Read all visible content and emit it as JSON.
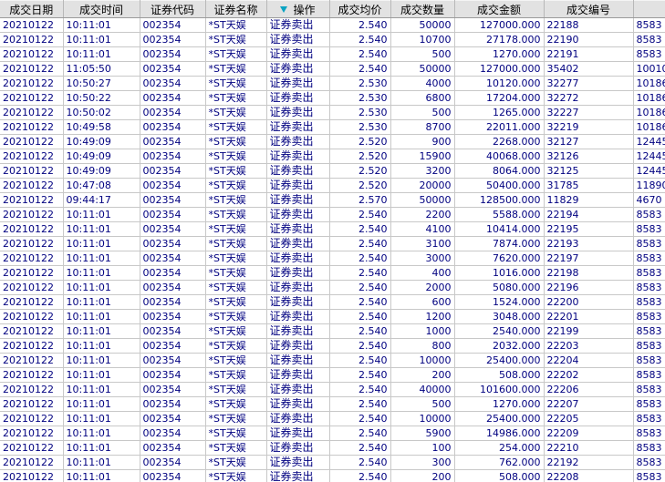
{
  "header": {
    "date": "成交日期",
    "time": "成交时间",
    "code": "证券代码",
    "name": "证券名称",
    "op": "操作",
    "price": "成交均价",
    "qty": "成交数量",
    "amount": "成交金额",
    "deal_no": "成交编号",
    "extra": ""
  },
  "rows": [
    {
      "date": "20210122",
      "time": "10:11:01",
      "code": "002354",
      "name": "*ST天娱",
      "op": "证券卖出",
      "price": "2.540",
      "qty": "50000",
      "amount": "127000.000",
      "deal_no": "22188",
      "extra": "8583"
    },
    {
      "date": "20210122",
      "time": "10:11:01",
      "code": "002354",
      "name": "*ST天娱",
      "op": "证券卖出",
      "price": "2.540",
      "qty": "10700",
      "amount": "27178.000",
      "deal_no": "22190",
      "extra": "8583"
    },
    {
      "date": "20210122",
      "time": "10:11:01",
      "code": "002354",
      "name": "*ST天娱",
      "op": "证券卖出",
      "price": "2.540",
      "qty": "500",
      "amount": "1270.000",
      "deal_no": "22191",
      "extra": "8583"
    },
    {
      "date": "20210122",
      "time": "11:05:50",
      "code": "002354",
      "name": "*ST天娱",
      "op": "证券卖出",
      "price": "2.540",
      "qty": "50000",
      "amount": "127000.000",
      "deal_no": "35402",
      "extra": "10010"
    },
    {
      "date": "20210122",
      "time": "10:50:27",
      "code": "002354",
      "name": "*ST天娱",
      "op": "证券卖出",
      "price": "2.530",
      "qty": "4000",
      "amount": "10120.000",
      "deal_no": "32277",
      "extra": "10186"
    },
    {
      "date": "20210122",
      "time": "10:50:22",
      "code": "002354",
      "name": "*ST天娱",
      "op": "证券卖出",
      "price": "2.530",
      "qty": "6800",
      "amount": "17204.000",
      "deal_no": "32272",
      "extra": "10186"
    },
    {
      "date": "20210122",
      "time": "10:50:02",
      "code": "002354",
      "name": "*ST天娱",
      "op": "证券卖出",
      "price": "2.530",
      "qty": "500",
      "amount": "1265.000",
      "deal_no": "32227",
      "extra": "10186"
    },
    {
      "date": "20210122",
      "time": "10:49:58",
      "code": "002354",
      "name": "*ST天娱",
      "op": "证券卖出",
      "price": "2.530",
      "qty": "8700",
      "amount": "22011.000",
      "deal_no": "32219",
      "extra": "10186"
    },
    {
      "date": "20210122",
      "time": "10:49:09",
      "code": "002354",
      "name": "*ST天娱",
      "op": "证券卖出",
      "price": "2.520",
      "qty": "900",
      "amount": "2268.000",
      "deal_no": "32127",
      "extra": "12445"
    },
    {
      "date": "20210122",
      "time": "10:49:09",
      "code": "002354",
      "name": "*ST天娱",
      "op": "证券卖出",
      "price": "2.520",
      "qty": "15900",
      "amount": "40068.000",
      "deal_no": "32126",
      "extra": "12445"
    },
    {
      "date": "20210122",
      "time": "10:49:09",
      "code": "002354",
      "name": "*ST天娱",
      "op": "证券卖出",
      "price": "2.520",
      "qty": "3200",
      "amount": "8064.000",
      "deal_no": "32125",
      "extra": "12445"
    },
    {
      "date": "20210122",
      "time": "10:47:08",
      "code": "002354",
      "name": "*ST天娱",
      "op": "证券卖出",
      "price": "2.520",
      "qty": "20000",
      "amount": "50400.000",
      "deal_no": "31785",
      "extra": "11890"
    },
    {
      "date": "20210122",
      "time": "09:44:17",
      "code": "002354",
      "name": "*ST天娱",
      "op": "证券卖出",
      "price": "2.570",
      "qty": "50000",
      "amount": "128500.000",
      "deal_no": "11829",
      "extra": "4670"
    },
    {
      "date": "20210122",
      "time": "10:11:01",
      "code": "002354",
      "name": "*ST天娱",
      "op": "证券卖出",
      "price": "2.540",
      "qty": "2200",
      "amount": "5588.000",
      "deal_no": "22194",
      "extra": "8583"
    },
    {
      "date": "20210122",
      "time": "10:11:01",
      "code": "002354",
      "name": "*ST天娱",
      "op": "证券卖出",
      "price": "2.540",
      "qty": "4100",
      "amount": "10414.000",
      "deal_no": "22195",
      "extra": "8583"
    },
    {
      "date": "20210122",
      "time": "10:11:01",
      "code": "002354",
      "name": "*ST天娱",
      "op": "证券卖出",
      "price": "2.540",
      "qty": "3100",
      "amount": "7874.000",
      "deal_no": "22193",
      "extra": "8583"
    },
    {
      "date": "20210122",
      "time": "10:11:01",
      "code": "002354",
      "name": "*ST天娱",
      "op": "证券卖出",
      "price": "2.540",
      "qty": "3000",
      "amount": "7620.000",
      "deal_no": "22197",
      "extra": "8583"
    },
    {
      "date": "20210122",
      "time": "10:11:01",
      "code": "002354",
      "name": "*ST天娱",
      "op": "证券卖出",
      "price": "2.540",
      "qty": "400",
      "amount": "1016.000",
      "deal_no": "22198",
      "extra": "8583"
    },
    {
      "date": "20210122",
      "time": "10:11:01",
      "code": "002354",
      "name": "*ST天娱",
      "op": "证券卖出",
      "price": "2.540",
      "qty": "2000",
      "amount": "5080.000",
      "deal_no": "22196",
      "extra": "8583"
    },
    {
      "date": "20210122",
      "time": "10:11:01",
      "code": "002354",
      "name": "*ST天娱",
      "op": "证券卖出",
      "price": "2.540",
      "qty": "600",
      "amount": "1524.000",
      "deal_no": "22200",
      "extra": "8583"
    },
    {
      "date": "20210122",
      "time": "10:11:01",
      "code": "002354",
      "name": "*ST天娱",
      "op": "证券卖出",
      "price": "2.540",
      "qty": "1200",
      "amount": "3048.000",
      "deal_no": "22201",
      "extra": "8583"
    },
    {
      "date": "20210122",
      "time": "10:11:01",
      "code": "002354",
      "name": "*ST天娱",
      "op": "证券卖出",
      "price": "2.540",
      "qty": "1000",
      "amount": "2540.000",
      "deal_no": "22199",
      "extra": "8583"
    },
    {
      "date": "20210122",
      "time": "10:11:01",
      "code": "002354",
      "name": "*ST天娱",
      "op": "证券卖出",
      "price": "2.540",
      "qty": "800",
      "amount": "2032.000",
      "deal_no": "22203",
      "extra": "8583"
    },
    {
      "date": "20210122",
      "time": "10:11:01",
      "code": "002354",
      "name": "*ST天娱",
      "op": "证券卖出",
      "price": "2.540",
      "qty": "10000",
      "amount": "25400.000",
      "deal_no": "22204",
      "extra": "8583"
    },
    {
      "date": "20210122",
      "time": "10:11:01",
      "code": "002354",
      "name": "*ST天娱",
      "op": "证券卖出",
      "price": "2.540",
      "qty": "200",
      "amount": "508.000",
      "deal_no": "22202",
      "extra": "8583"
    },
    {
      "date": "20210122",
      "time": "10:11:01",
      "code": "002354",
      "name": "*ST天娱",
      "op": "证券卖出",
      "price": "2.540",
      "qty": "40000",
      "amount": "101600.000",
      "deal_no": "22206",
      "extra": "8583"
    },
    {
      "date": "20210122",
      "time": "10:11:01",
      "code": "002354",
      "name": "*ST天娱",
      "op": "证券卖出",
      "price": "2.540",
      "qty": "500",
      "amount": "1270.000",
      "deal_no": "22207",
      "extra": "8583"
    },
    {
      "date": "20210122",
      "time": "10:11:01",
      "code": "002354",
      "name": "*ST天娱",
      "op": "证券卖出",
      "price": "2.540",
      "qty": "10000",
      "amount": "25400.000",
      "deal_no": "22205",
      "extra": "8583"
    },
    {
      "date": "20210122",
      "time": "10:11:01",
      "code": "002354",
      "name": "*ST天娱",
      "op": "证券卖出",
      "price": "2.540",
      "qty": "5900",
      "amount": "14986.000",
      "deal_no": "22209",
      "extra": "8583"
    },
    {
      "date": "20210122",
      "time": "10:11:01",
      "code": "002354",
      "name": "*ST天娱",
      "op": "证券卖出",
      "price": "2.540",
      "qty": "100",
      "amount": "254.000",
      "deal_no": "22210",
      "extra": "8583"
    },
    {
      "date": "20210122",
      "time": "10:11:01",
      "code": "002354",
      "name": "*ST天娱",
      "op": "证券卖出",
      "price": "2.540",
      "qty": "300",
      "amount": "762.000",
      "deal_no": "22192",
      "extra": "8583"
    },
    {
      "date": "20210122",
      "time": "10:11:01",
      "code": "002354",
      "name": "*ST天娱",
      "op": "证券卖出",
      "price": "2.540",
      "qty": "200",
      "amount": "508.000",
      "deal_no": "22208",
      "extra": "8583"
    }
  ]
}
